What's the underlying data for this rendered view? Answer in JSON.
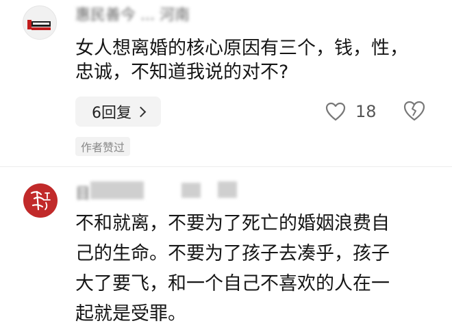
{
  "comments": [
    {
      "author": "惠民善今 ... 河南",
      "text": "女人想离婚的核心原因有三个，钱，性，\n忠诚，不知道我说的对不?",
      "reply_label": "6回复",
      "likes": "18",
      "author_badge": "作者赞过"
    },
    {
      "author": "目",
      "text": "不和就离，不要为了死亡的婚姻浪费自\n己的生命。不要为了孩子去凑乎，孩子\n大了要飞，和一个自己不喜欢的人在一\n起就是受罪。"
    }
  ],
  "icons": {
    "like": "heart-outline-icon",
    "dislike": "broken-heart-icon",
    "reply_chevron": "chevron-right-icon"
  },
  "colors": {
    "avatar2": "#c12a2a",
    "pill_bg": "#f3f3f3"
  }
}
